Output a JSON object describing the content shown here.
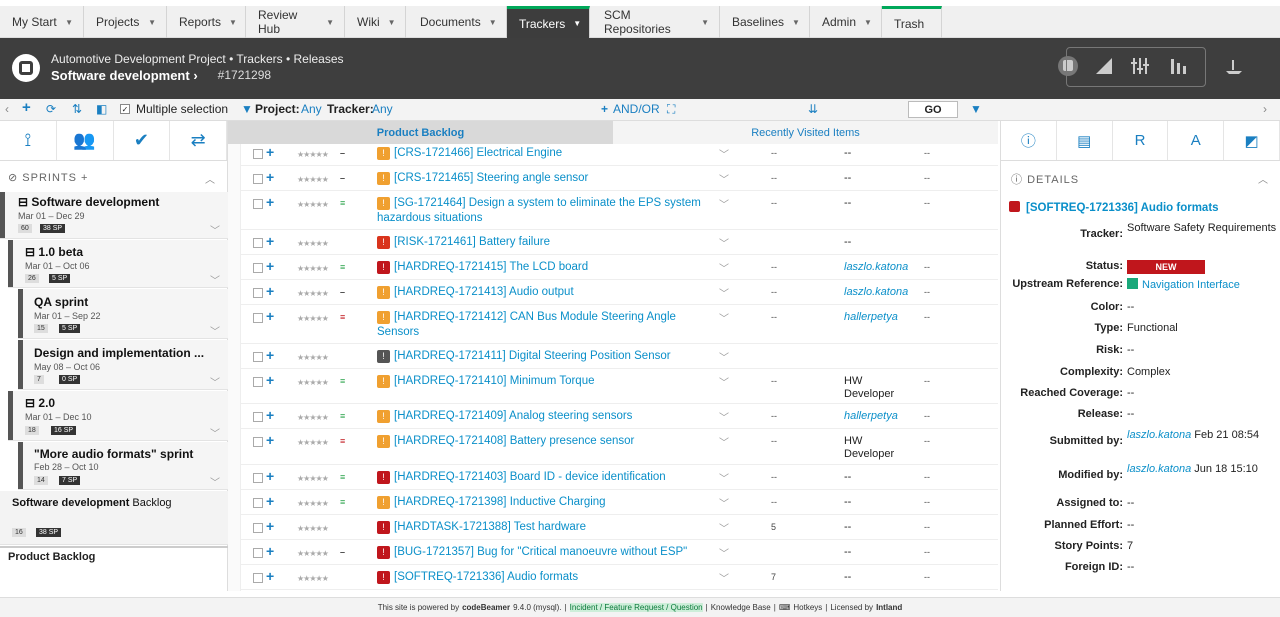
{
  "nav": {
    "tabs": [
      {
        "label": "My Start"
      },
      {
        "label": "Projects"
      },
      {
        "label": "Reports"
      },
      {
        "label": "Review Hub"
      },
      {
        "label": "Wiki"
      },
      {
        "label": "Documents"
      },
      {
        "label": "Trackers"
      },
      {
        "label": "SCM Repositories"
      },
      {
        "label": "Baselines"
      },
      {
        "label": "Admin"
      },
      {
        "label": "Trash"
      }
    ],
    "active": "Trackers"
  },
  "header": {
    "breadcrumb": "Automotive Development Project • Trackers • Releases",
    "title": "Software development",
    "title_arrow": "›",
    "item_id": "#1721298"
  },
  "toolbar": {
    "multiple_selection": "Multiple selection",
    "project_label": "Project:",
    "project_value": "Any",
    "tracker_label": "Tracker:",
    "tracker_value": "Any",
    "and_or": "AND/OR",
    "go": "GO"
  },
  "left_panel": {
    "section_title": "SPRINTS",
    "sprints": [
      {
        "name": "Software development",
        "dates": "Mar 01 – Dec 29",
        "count": "60",
        "sp": "38 SP"
      },
      {
        "name": "1.0 beta",
        "dates": "Mar 01 – Oct 06",
        "count": "26",
        "sp": "5 SP"
      },
      {
        "name": "QA sprint",
        "dates": "Mar 01 – Sep 22",
        "count": "15",
        "sp": "5 SP"
      },
      {
        "name": "Design and implementation ...",
        "dates": "May 08 – Oct 06",
        "count": "7",
        "sp": "0 SP"
      },
      {
        "name": "2.0",
        "dates": "Mar 01 – Dec 10",
        "count": "18",
        "sp": "16 SP"
      },
      {
        "name": "\"More audio formats\" sprint",
        "dates": "Feb 28 – Oct 10",
        "count": "14",
        "sp": "7 SP"
      }
    ],
    "backlog": {
      "name_bold": "Software development",
      "name_rest": " Backlog",
      "count": "16",
      "sp": "38 SP"
    },
    "product_backlog": "Product Backlog"
  },
  "center_tabs": {
    "tab1": "Product Backlog",
    "tab2": "Recently Visited Items"
  },
  "rows": [
    {
      "title": "[CRS-1721466]  Electrical Engine",
      "icon_color": "#f0a030",
      "prio": "–",
      "prio_color": "#444",
      "c5": "--",
      "c6": "--",
      "c6_link": false,
      "c7": "--"
    },
    {
      "title": "[CRS-1721465]  Steering angle sensor",
      "icon_color": "#f0a030",
      "prio": "–",
      "prio_color": "#444",
      "c5": "--",
      "c6": "--",
      "c6_link": false,
      "c7": "--"
    },
    {
      "title": "[SG-1721464]  Design a system to eliminate the EPS system hazardous situations",
      "icon_color": "#f0a030",
      "prio": "≡",
      "prio_color": "#2aa34a",
      "c5": "--",
      "c6": "--",
      "c6_link": false,
      "c7": "--"
    },
    {
      "title": "[RISK-1721461]  Battery failure",
      "icon_color": "#d9341c",
      "prio": "",
      "prio_color": "#444",
      "c5": "",
      "c6": "--",
      "c6_link": false,
      "c7": ""
    },
    {
      "title": "[HARDREQ-1721415]  The LCD board",
      "icon_color": "#c0161c",
      "prio": "≡",
      "prio_color": "#2aa34a",
      "c5": "--",
      "c6": "laszlo.katona",
      "c6_link": true,
      "c7": "--"
    },
    {
      "title": "[HARDREQ-1721413]  Audio output",
      "icon_color": "#f0a030",
      "prio": "–",
      "prio_color": "#444",
      "c5": "--",
      "c6": "laszlo.katona",
      "c6_link": true,
      "c7": "--"
    },
    {
      "title": "[HARDREQ-1721412]  CAN Bus Module Steering Angle Sensors",
      "icon_color": "#f0a030",
      "prio": "≡",
      "prio_color": "#c0161c",
      "c5": "--",
      "c6": "hallerpetya",
      "c6_link": true,
      "c7": "--"
    },
    {
      "title": "[HARDREQ-1721411]  Digital Steering Position Sensor",
      "icon_color": "#555555",
      "prio": "",
      "prio_color": "#444",
      "c5": "",
      "c6": "",
      "c6_link": false,
      "c7": ""
    },
    {
      "title": "[HARDREQ-1721410]  Minimum Torque",
      "icon_color": "#f0a030",
      "prio": "≡",
      "prio_color": "#2aa34a",
      "c5": "--",
      "c6": "HW Developer",
      "c6_link": false,
      "c7": "--"
    },
    {
      "title": "[HARDREQ-1721409]  Analog steering sensors",
      "icon_color": "#f0a030",
      "prio": "≡",
      "prio_color": "#2aa34a",
      "c5": "--",
      "c6": "hallerpetya",
      "c6_link": true,
      "c7": "--"
    },
    {
      "title": "[HARDREQ-1721408]  Battery presence sensor",
      "icon_color": "#f0a030",
      "prio": "≡",
      "prio_color": "#c0161c",
      "c5": "--",
      "c6": "HW Developer",
      "c6_link": false,
      "c7": "--"
    },
    {
      "title": "[HARDREQ-1721403]  Board ID - device identification",
      "icon_color": "#c0161c",
      "prio": "≡",
      "prio_color": "#2aa34a",
      "c5": "--",
      "c6": "--",
      "c6_link": false,
      "c7": "--"
    },
    {
      "title": "[HARDREQ-1721398]  Inductive Charging",
      "icon_color": "#f0a030",
      "prio": "≡",
      "prio_color": "#2aa34a",
      "c5": "--",
      "c6": "--",
      "c6_link": false,
      "c7": "--"
    },
    {
      "title": "[HARDTASK-1721388]  Test hardware",
      "icon_color": "#c0161c",
      "prio": "",
      "prio_color": "#444",
      "c5": "5",
      "c6": "--",
      "c6_link": false,
      "c7": "--"
    },
    {
      "title": "[BUG-1721357]  Bug for \"Critical manoeuvre without ESP\"",
      "icon_color": "#c0161c",
      "prio": "–",
      "prio_color": "#444",
      "c5": "",
      "c6": "--",
      "c6_link": false,
      "c7": "--"
    },
    {
      "title": "[SOFTREQ-1721336]  Audio formats",
      "icon_color": "#c0161c",
      "prio": "",
      "prio_color": "#444",
      "c5": "7",
      "c6": "--",
      "c6_link": false,
      "c7": "--"
    }
  ],
  "details": {
    "section_title": "DETAILS",
    "item_title": "[SOFTREQ-1721336]  Audio formats",
    "fields": [
      {
        "label": "Tracker:",
        "value": "Software Safety Requirements"
      },
      {
        "label": "Status:",
        "value": "NEW",
        "badge": true
      },
      {
        "label": "Upstream Reference:",
        "value": "Navigation Interface",
        "link": true
      },
      {
        "label": "Color:",
        "value": "--"
      },
      {
        "label": "Type:",
        "value": "Functional"
      },
      {
        "label": "Risk:",
        "value": "--"
      },
      {
        "label": "Complexity:",
        "value": "Complex"
      },
      {
        "label": "Reached Coverage:",
        "value": "--"
      },
      {
        "label": "Release:",
        "value": "--"
      },
      {
        "label": "Submitted by:",
        "user": "laszlo.katona",
        "value": " Feb 21 08:54"
      },
      {
        "label": "Modified by:",
        "user": "laszlo.katona",
        "value": " Jun 18 15:10"
      },
      {
        "label": "Assigned to:",
        "value": "--"
      },
      {
        "label": "Planned Effort:",
        "value": "--"
      },
      {
        "label": "Story Points:",
        "value": "7"
      },
      {
        "label": "Foreign ID:",
        "value": "--"
      }
    ]
  },
  "footer": {
    "powered": "This site is powered by",
    "product": "codeBeamer",
    "version": "9.4.0 (mysql).",
    "incident": "Incident / Feature Request / Question",
    "kb": "Knowledge Base",
    "hotkeys": "Hotkeys",
    "licensed": "Licensed by",
    "company": "Intland"
  }
}
